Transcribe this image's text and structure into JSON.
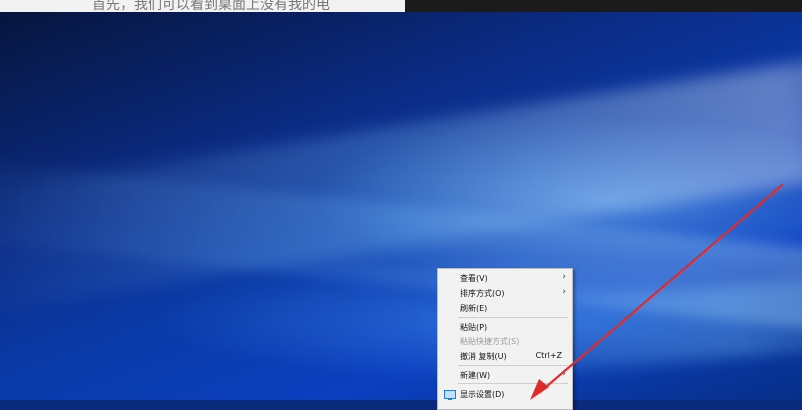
{
  "top_strip": {
    "text": "首先，我们可以看到桌面上没有我的电"
  },
  "context_menu": {
    "items": [
      {
        "label": "查看(V)",
        "has_submenu": true
      },
      {
        "label": "排序方式(O)",
        "has_submenu": true
      },
      {
        "label": "刷新(E)"
      },
      {
        "label": "粘贴(P)"
      },
      {
        "label": "粘贴快捷方式(S)",
        "disabled": true
      },
      {
        "label": "撤消 复制(U)",
        "shortcut": "Ctrl+Z"
      },
      {
        "label": "新建(W)",
        "has_submenu": true
      },
      {
        "label": "显示设置(D)",
        "icon": "display-settings-icon"
      }
    ],
    "chevron": "›"
  },
  "colors": {
    "desktop_blue": "#0b3fbf",
    "menu_bg": "#f2f2f2",
    "arrow_red": "#e02b2b"
  }
}
